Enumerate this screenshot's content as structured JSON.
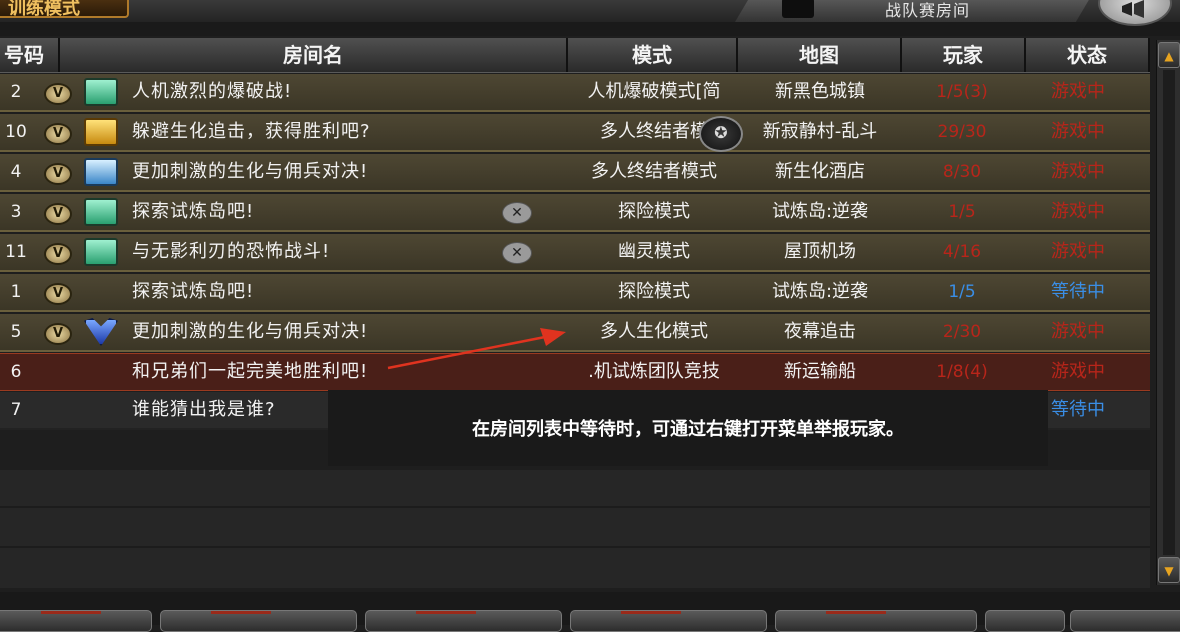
{
  "topbar": {
    "mode_tab": "训练模式",
    "room_tab": "战队赛房间"
  },
  "columns": {
    "num": "号码",
    "name": "房间名",
    "mode": "模式",
    "map": "地图",
    "players": "玩家",
    "status": "状态"
  },
  "rows": [
    {
      "num": "2",
      "badge": "green",
      "name": "人机激烈的爆破战!",
      "mode": "人机爆破模式[简",
      "map": "新黑色城镇",
      "players": "1/5(3)",
      "status": "游戏中"
    },
    {
      "num": "10",
      "badge": "gold",
      "name": "躲避生化追击，获得胜利吧?",
      "mode": "多人终结者模",
      "map": "新寂静村-乱斗",
      "players": "29/30",
      "status": "游戏中"
    },
    {
      "num": "4",
      "badge": "blue",
      "name": "更加刺激的生化与佣兵对决!",
      "mode": "多人终结者模式",
      "map": "新生化酒店",
      "players": "8/30",
      "status": "游戏中"
    },
    {
      "num": "3",
      "badge": "green",
      "name": "探索试炼岛吧!",
      "mode": "探险模式",
      "map": "试炼岛:逆袭",
      "players": "1/5",
      "status": "游戏中"
    },
    {
      "num": "11",
      "badge": "green",
      "name": "与无影利刃的恐怖战斗!",
      "mode": "幽灵模式",
      "map": "屋顶机场",
      "players": "4/16",
      "status": "游戏中"
    },
    {
      "num": "1",
      "badge": "",
      "name": "探索试炼岛吧!",
      "mode": "探险模式",
      "map": "试炼岛:逆袭",
      "players": "1/5",
      "status": "等待中"
    },
    {
      "num": "5",
      "badge": "crest",
      "name": "更加刺激的生化与佣兵对决!",
      "mode": "多人生化模式",
      "map": "夜幕追击",
      "players": "2/30",
      "status": "游戏中"
    },
    {
      "num": "6",
      "badge": "",
      "name": "和兄弟们一起完美地胜利吧!",
      "mode": ".机试炼团队竞技",
      "map": "新运输船",
      "players": "1/8(4)",
      "status": "游戏中"
    },
    {
      "num": "7",
      "badge": "",
      "name": "谁能猜出我是谁?",
      "mode": "",
      "map": "",
      "players": "",
      "status": "等待中"
    }
  ],
  "badge_letter": "V",
  "tooltip": "在房间列表中等待时，可通过右键打开菜单举报玩家。",
  "colors": {
    "playing": "#b8251a",
    "waiting": "#3a8ee6",
    "row_bg": "#4a4430",
    "selected_row": "#4a1f18"
  }
}
